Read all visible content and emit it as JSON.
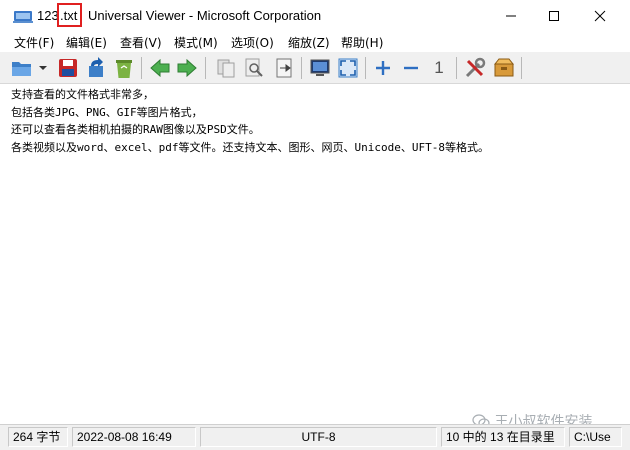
{
  "window": {
    "file_name": "123",
    "file_ext": ".txt",
    "title_rest": "Universal Viewer - Microsoft Corporation"
  },
  "menu": [
    "文件(F)",
    "编辑(E)",
    "查看(V)",
    "模式(M)",
    "选项(O)",
    "缩放(Z)",
    "帮助(H)"
  ],
  "toolbar": {
    "zoom_one_label": "1"
  },
  "content": {
    "lines": [
      "支持查看的文件格式非常多，",
      "包括各类JPG、PNG、GIF等图片格式，",
      "还可以查看各类相机拍摄的RAW图像以及PSD文件。",
      "各类视频以及word、excel、pdf等文件。还支持文本、图形、网页、Unicode、UFT-8等格式。"
    ]
  },
  "status": {
    "size": "264 字节",
    "datetime": "2022-08-08 16:49",
    "encoding": "UTF-8",
    "position": "10 中的 13 在目录里",
    "path": "C:\\Use"
  },
  "watermark": "王小叔软件安装",
  "colors": {
    "highlight_box": "#e02020",
    "toolbar_bg": "#f0f0f0",
    "status_bg": "#f0f0f0"
  }
}
